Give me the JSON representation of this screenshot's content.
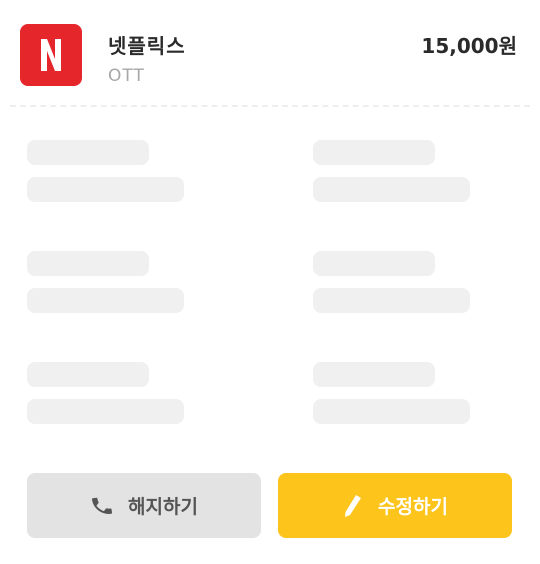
{
  "service": {
    "logo_letter": "N",
    "logo_color": "#e5262a",
    "name": "넷플릭스",
    "category": "OTT",
    "price": "15,000원"
  },
  "actions": {
    "cancel": {
      "label": "해지하기",
      "icon": "phone-icon",
      "color": "#e3e3e3"
    },
    "edit": {
      "label": "수정하기",
      "icon": "pencil-icon",
      "color": "#fdc41c"
    }
  }
}
